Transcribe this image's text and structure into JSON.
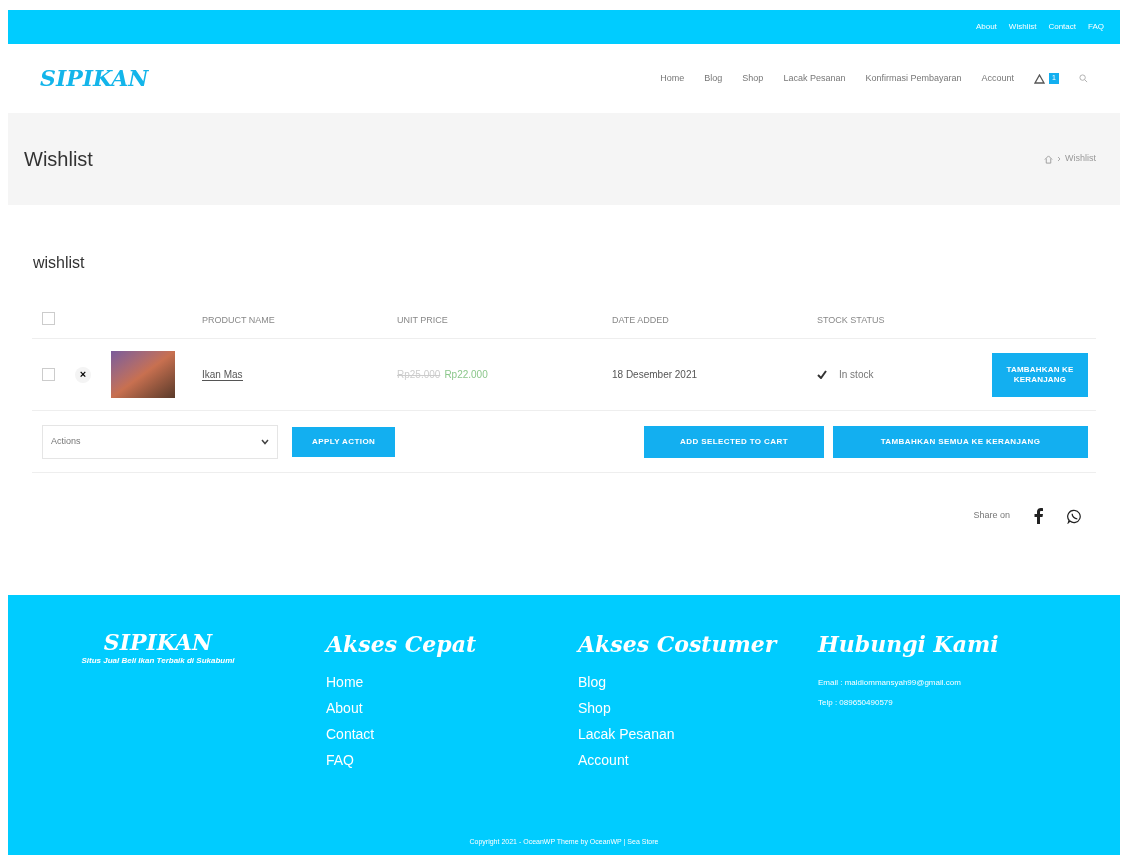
{
  "top_bar": {
    "links": [
      "About",
      "Wishlist",
      "Contact",
      "FAQ"
    ]
  },
  "header": {
    "logo": "SIPIKAN",
    "nav": [
      {
        "label": "Home",
        "selected": false
      },
      {
        "label": "Blog",
        "selected": false
      },
      {
        "label": "Shop",
        "selected": false
      },
      {
        "label": "Lacak Pesanan",
        "selected": false
      },
      {
        "label": "Konfirmasi Pembayaran",
        "selected": false
      },
      {
        "label": "Account",
        "selected": false
      }
    ],
    "cart_count": "1"
  },
  "page_header": {
    "title": "Wishlist",
    "breadcrumb": "Wishlist"
  },
  "wishlist": {
    "title": "wishlist",
    "select_all_checked": false,
    "columns": [
      "PRODUCT NAME",
      "UNIT PRICE",
      "DATE ADDED",
      "STOCK STATUS"
    ],
    "rows": [
      {
        "checked": false,
        "remove": "×",
        "name": "Ikan Mas",
        "old_price": "Rp25.000",
        "price": "Rp22.000",
        "date": "18 Desember 2021",
        "stock": "In stock",
        "in_stock": true,
        "action": "TAMBAHKAN KE KERANJANG"
      }
    ],
    "actions_select": "Actions",
    "apply": "APPLY ACTION",
    "add_selected": "ADD SELECTED TO CART",
    "add_all": "TAMBAHKAN SEMUA KE KERANJANG",
    "share_label": "Share on"
  },
  "footer": {
    "logo": "SIPIKAN",
    "tagline": "Situs Jual Beli Ikan Terbaik di Sukabumi",
    "columns": [
      {
        "title": "Akses Cepat",
        "links": [
          "Home",
          "About",
          "Contact",
          "FAQ"
        ]
      },
      {
        "title": "Akses Costumer",
        "links": [
          "Blog",
          "Shop",
          "Lacak Pesanan",
          "Account"
        ]
      }
    ],
    "contact": {
      "title": "Hubungi Kami",
      "lines": [
        "Email : maldiommansyah99@gmail.com",
        "Telp : 089650490579"
      ]
    },
    "copyright": "Copyright 2021 - OceanWP Theme by OceanWP | Sea Store"
  }
}
